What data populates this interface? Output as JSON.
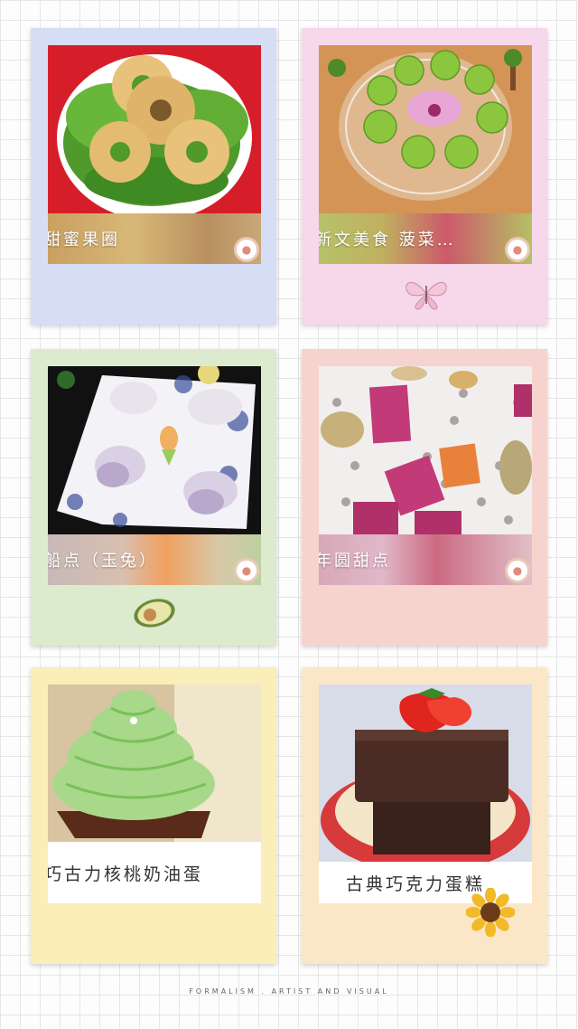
{
  "cards": [
    {
      "caption": "甜蜜果圈"
    },
    {
      "caption": "新文美食  菠菜…"
    },
    {
      "caption": "船点（玉兔）"
    },
    {
      "caption": "年圆甜点"
    },
    {
      "caption": "巧古力核桃奶油蛋"
    },
    {
      "caption": "古典巧克力蛋糕"
    }
  ],
  "footer": "FORMALISM . ARTIST AND VISUAL"
}
